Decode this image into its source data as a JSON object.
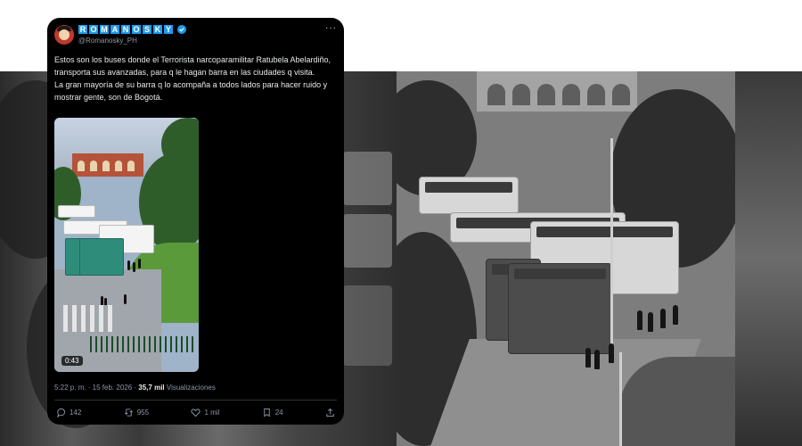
{
  "tweet": {
    "display_name_letters": [
      "R",
      "O",
      "M",
      "A",
      "N",
      "O",
      "S",
      "K",
      "Y"
    ],
    "handle": "@Romanosky_PH",
    "more_icon": "more-icon",
    "text_paragraphs": [
      "Estos son los buses donde el Terrorista narcoparamilitar Ratubela Abelardiño, transporta sus avanzadas, para q le hagan barra en las ciudades q visita.",
      "La gran mayoría de su barra q lo acompaña a todos lados para hacer ruido y mostrar gente, son de Bogotá."
    ],
    "video_duration": "0:43",
    "timestamp": "5:22 p. m. · 15 feb. 2026 · ",
    "views_count": "35,7 mil",
    "views_label": "Visualizaciones",
    "actions": {
      "replies": "142",
      "reposts": "955",
      "likes": "1 mil",
      "bookmarks": "24"
    },
    "colors": {
      "background": "#000000",
      "text": "#e7e9ea",
      "muted": "#8b98a5",
      "accent": "#1d9bf0"
    }
  }
}
